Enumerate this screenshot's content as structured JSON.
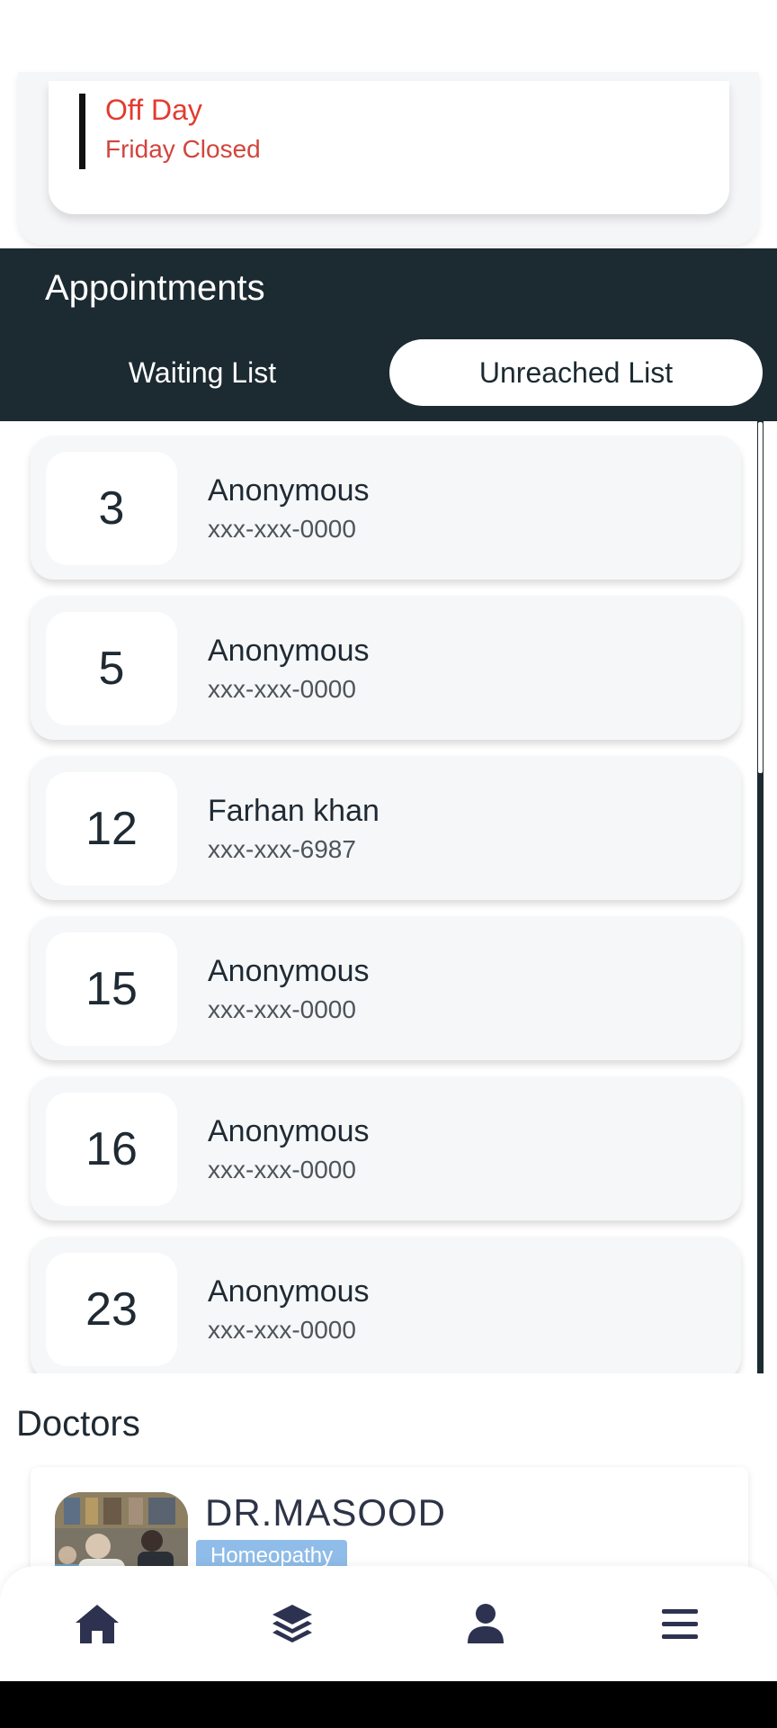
{
  "off_day": {
    "title": "Off Day",
    "subtitle": "Friday Closed"
  },
  "appointments": {
    "title": "Appointments",
    "tabs": [
      {
        "label": "Waiting List",
        "selected": false
      },
      {
        "label": "Unreached List",
        "selected": true
      }
    ],
    "items": [
      {
        "token": "3",
        "name": "Anonymous",
        "phone": "xxx-xxx-0000"
      },
      {
        "token": "5",
        "name": "Anonymous",
        "phone": "xxx-xxx-0000"
      },
      {
        "token": "12",
        "name": "Farhan khan",
        "phone": "xxx-xxx-6987"
      },
      {
        "token": "15",
        "name": "Anonymous",
        "phone": "xxx-xxx-0000"
      },
      {
        "token": "16",
        "name": "Anonymous",
        "phone": "xxx-xxx-0000"
      },
      {
        "token": "23",
        "name": "Anonymous",
        "phone": "xxx-xxx-0000"
      }
    ]
  },
  "doctors": {
    "title": "Doctors",
    "items": [
      {
        "name": "DR.MASOOD",
        "specialty": "Homeopathy"
      }
    ]
  },
  "bottom_nav": {
    "items": [
      {
        "icon": "home-icon"
      },
      {
        "icon": "layers-icon"
      },
      {
        "icon": "user-icon"
      },
      {
        "icon": "menu-icon"
      }
    ]
  },
  "colors": {
    "header_bg": "#1c2a31",
    "off_day_red": "#e23b30",
    "badge_blue": "#8fbce8"
  }
}
